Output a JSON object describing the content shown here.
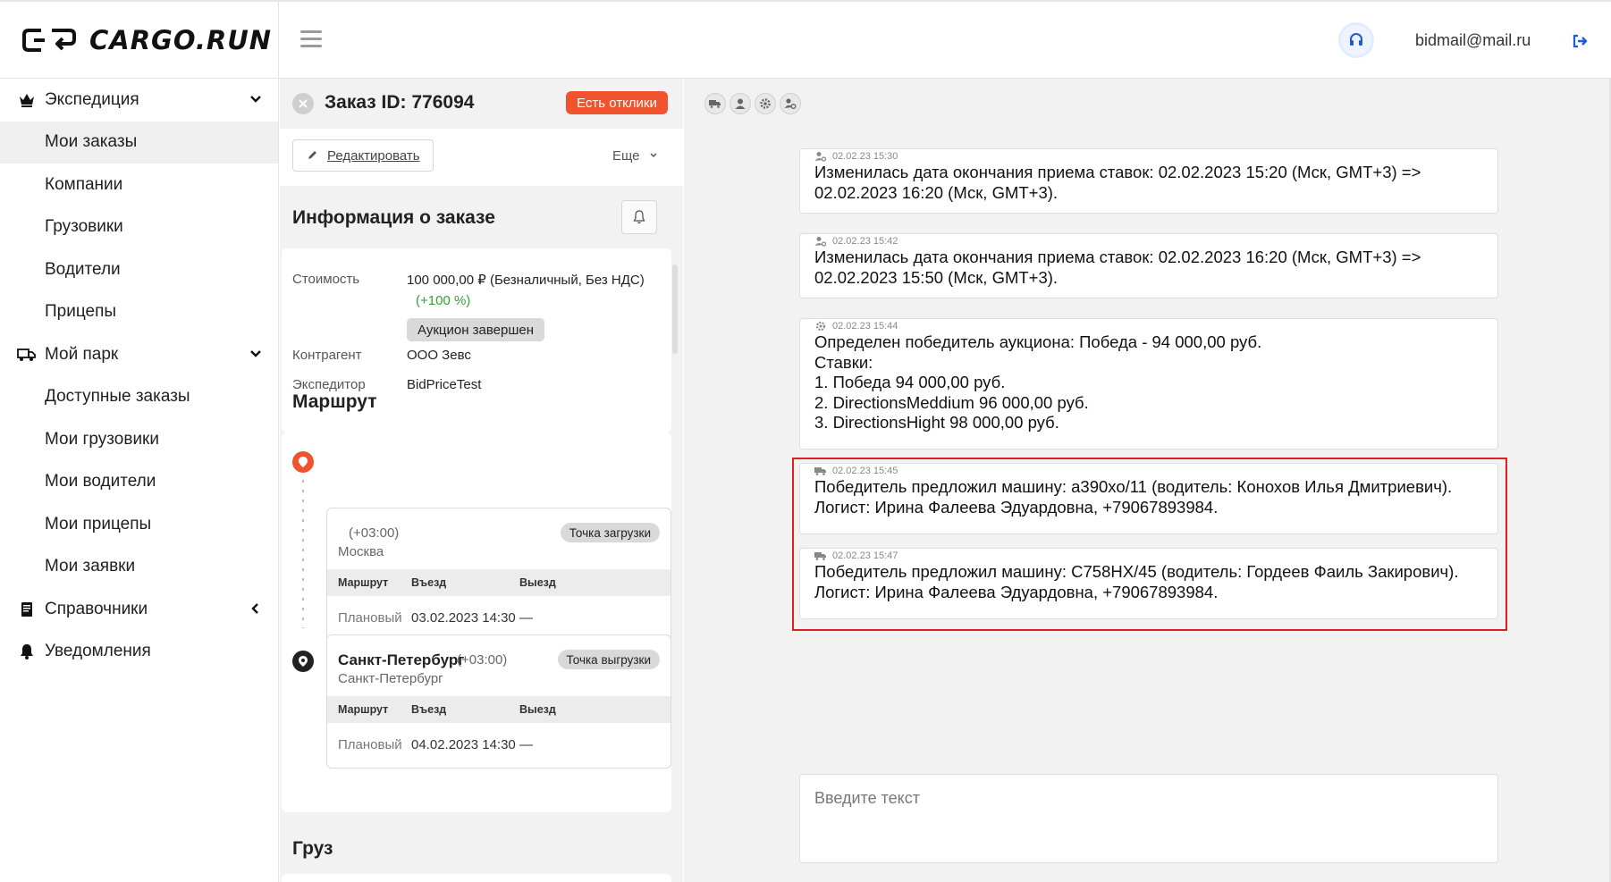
{
  "header": {
    "logo_text": "CARGO.RUN",
    "user_email": "bidmail@mail.ru"
  },
  "sidebar": {
    "groups": [
      {
        "label": "Экспедиция",
        "icon": "crown-icon",
        "expanded": true,
        "items": [
          "Мои заказы",
          "Компании",
          "Грузовики",
          "Водители",
          "Прицепы"
        ]
      },
      {
        "label": "Мой парк",
        "icon": "truck-icon",
        "expanded": true,
        "items": [
          "Доступные заказы",
          "Мои грузовики",
          "Мои водители",
          "Мои прицепы",
          "Мои заявки"
        ]
      },
      {
        "label": "Справочники",
        "icon": "book-icon",
        "expanded": false
      },
      {
        "label": "Уведомления",
        "icon": "bell-icon"
      }
    ],
    "active_item": "Мои заказы"
  },
  "order": {
    "title": "Заказ ID: 776094",
    "badge": "Есть отклики",
    "edit_label": "Редактировать",
    "more_label": "Еще",
    "info_title": "Информация о заказе",
    "cost_label": "Стоимость",
    "cost_value": "100 000,00 ₽ (Безналичный, Без НДС)",
    "cost_delta": "(+100 %)",
    "auction_status": "Аукцион завершен",
    "counterparty_label": "Контрагент",
    "counterparty_value": "ООО Зевс",
    "forwarder_label": "Экспедитор",
    "forwarder_value": "BidPriceTest",
    "route_title": "Маршрут",
    "cargo_title": "Груз",
    "points": [
      {
        "city": "",
        "tz": "(+03:00)",
        "sub": "Москва",
        "type": "Точка загрузки",
        "col_route": "Маршрут",
        "col_in": "Въезд",
        "col_out": "Выезд",
        "row_label": "Плановый",
        "row_in": "03.02.2023 14:30",
        "row_out": "—"
      },
      {
        "city": "Санкт-Петербург",
        "tz": "(+03:00)",
        "sub": "Санкт-Петербург",
        "type": "Точка выгрузки",
        "col_route": "Маршрут",
        "col_in": "Въезд",
        "col_out": "Выезд",
        "row_label": "Плановый",
        "row_in": "04.02.2023 14:30",
        "row_out": "—"
      }
    ]
  },
  "log": {
    "filter_icons": [
      "truck-filter-icon",
      "user-filter-icon",
      "gear-filter-icon",
      "user-gear-filter-icon"
    ],
    "entries": [
      {
        "icon": "user-gear-icon",
        "time": "02.02.23 15:30",
        "lines": [
          "Изменилась дата окончания приема ставок: 02.02.2023 15:20 (Мск, GMT+3) =>",
          "02.02.2023 16:20 (Мск, GMT+3)."
        ]
      },
      {
        "icon": "user-gear-icon",
        "time": "02.02.23 15:42",
        "lines": [
          "Изменилась дата окончания приема ставок: 02.02.2023 16:20 (Мск, GMT+3) =>",
          "02.02.2023 15:50 (Мск, GMT+3)."
        ]
      },
      {
        "icon": "gear-icon",
        "time": "02.02.23 15:44",
        "lines": [
          "Определен победитель аукциона: Победа - 94 000,00 руб.",
          "Ставки:",
          "1. Победа 94 000,00 руб.",
          "2. DirectionsMeddium 96 000,00 руб.",
          "3. DirectionsHight 98 000,00 руб."
        ]
      },
      {
        "icon": "truck-icon",
        "time": "02.02.23 15:45",
        "lines": [
          "Победитель предложил машину: а390хо/11 (водитель: Конохов Илья Дмитриевич).",
          "Логист: Ирина Фалеева Эдуардовна, +79067893984."
        ]
      },
      {
        "icon": "truck-icon",
        "time": "02.02.23 15:47",
        "lines": [
          "Победитель предложил машину: С758НХ/45 (водитель: Гордеев Фаиль Закирович).",
          "Логист: Ирина Фалеева Эдуардовна, +79067893984."
        ]
      }
    ],
    "input_placeholder": "Введите текст"
  },
  "colors": {
    "accent_badge": "#f0532d",
    "positive": "#3a9a3a",
    "highlight_border": "#e02020",
    "start_pin": "#f0532d",
    "end_pin": "#222222"
  }
}
